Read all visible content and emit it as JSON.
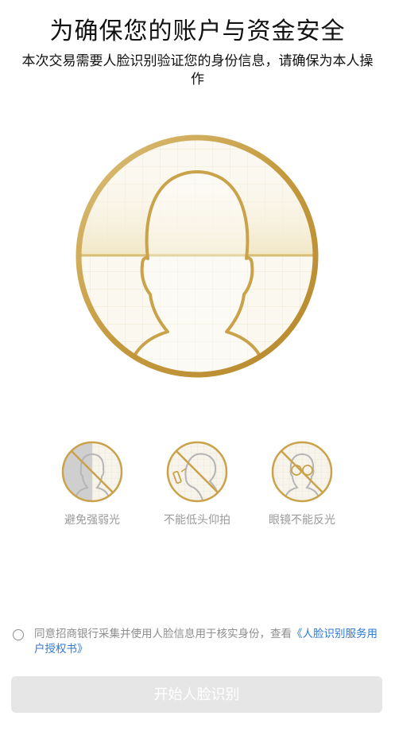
{
  "header": {
    "title": "为确保您的账户与资金安全",
    "subtitle": "本次交易需要人脸识别验证您的身份信息，请确保为本人操作"
  },
  "illustration": {
    "icon": "face-outline-icon",
    "accent_color": "#c9a24a"
  },
  "tips": [
    {
      "icon": "avoid-strong-light-icon",
      "label": "避免强弱光"
    },
    {
      "icon": "no-head-tilt-icon",
      "label": "不能低头仰拍"
    },
    {
      "icon": "no-glasses-glare-icon",
      "label": "眼镜不能反光"
    }
  ],
  "consent": {
    "checked": false,
    "text": "同意招商银行采集并使用人脸信息用于核实身份，查看",
    "link_text": "《人脸识别服务用户授权书》"
  },
  "actions": {
    "start_label": "开始人脸识别",
    "enabled": false
  },
  "colors": {
    "gold": "#c9a24a",
    "link": "#2f7ad3",
    "disabled_button": "#e6e6e6"
  }
}
